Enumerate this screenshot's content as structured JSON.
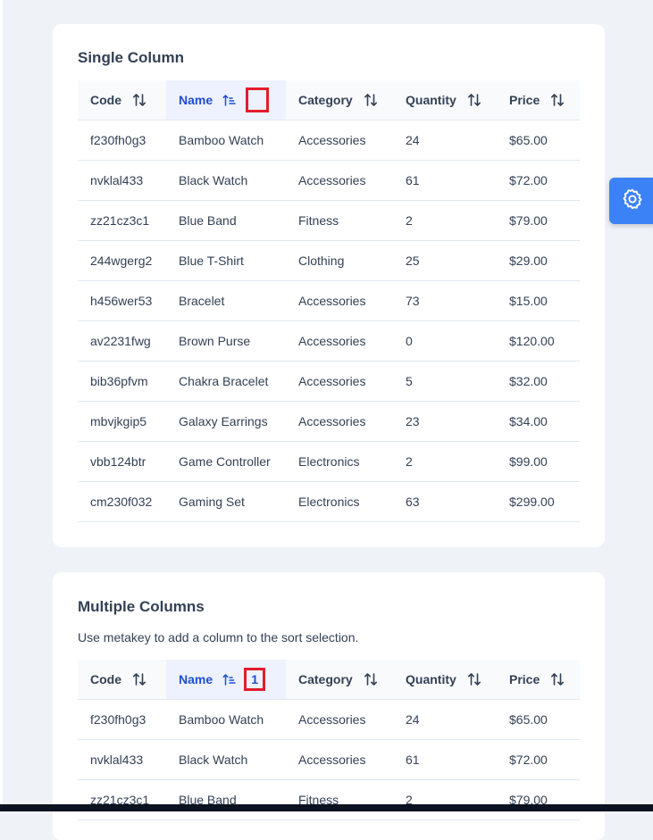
{
  "columns": [
    {
      "key": "code",
      "label": "Code"
    },
    {
      "key": "name",
      "label": "Name"
    },
    {
      "key": "category",
      "label": "Category"
    },
    {
      "key": "quantity",
      "label": "Quantity"
    },
    {
      "key": "price",
      "label": "Price"
    }
  ],
  "single": {
    "title": "Single Column",
    "sorted_column": "Name",
    "sort_badge": "",
    "rows": [
      [
        "f230fh0g3",
        "Bamboo Watch",
        "Accessories",
        "24",
        "$65.00"
      ],
      [
        "nvklal433",
        "Black Watch",
        "Accessories",
        "61",
        "$72.00"
      ],
      [
        "zz21cz3c1",
        "Blue Band",
        "Fitness",
        "2",
        "$79.00"
      ],
      [
        "244wgerg2",
        "Blue T-Shirt",
        "Clothing",
        "25",
        "$29.00"
      ],
      [
        "h456wer53",
        "Bracelet",
        "Accessories",
        "73",
        "$15.00"
      ],
      [
        "av2231fwg",
        "Brown Purse",
        "Accessories",
        "0",
        "$120.00"
      ],
      [
        "bib36pfvm",
        "Chakra Bracelet",
        "Accessories",
        "5",
        "$32.00"
      ],
      [
        "mbvjkgip5",
        "Galaxy Earrings",
        "Accessories",
        "23",
        "$34.00"
      ],
      [
        "vbb124btr",
        "Game Controller",
        "Electronics",
        "2",
        "$99.00"
      ],
      [
        "cm230f032",
        "Gaming Set",
        "Electronics",
        "63",
        "$299.00"
      ]
    ]
  },
  "multiple": {
    "title": "Multiple Columns",
    "description": "Use metakey to add a column to the sort selection.",
    "sorted_column": "Name",
    "sort_badge": "1",
    "rows": [
      [
        "f230fh0g3",
        "Bamboo Watch",
        "Accessories",
        "24",
        "$65.00"
      ],
      [
        "nvklal433",
        "Black Watch",
        "Accessories",
        "61",
        "$72.00"
      ],
      [
        "zz21cz3c1",
        "Blue Band",
        "Fitness",
        "2",
        "$79.00"
      ]
    ]
  },
  "colors": {
    "accent": "#3b82f6",
    "sorted_header_bg": "#eef2ff",
    "sorted_header_text": "#1d4ed8",
    "highlight_box": "#e11d2a"
  },
  "icons": {
    "sort": "sort-alt-icon",
    "sort_asc": "sort-amount-up-icon",
    "settings": "cog-icon"
  }
}
